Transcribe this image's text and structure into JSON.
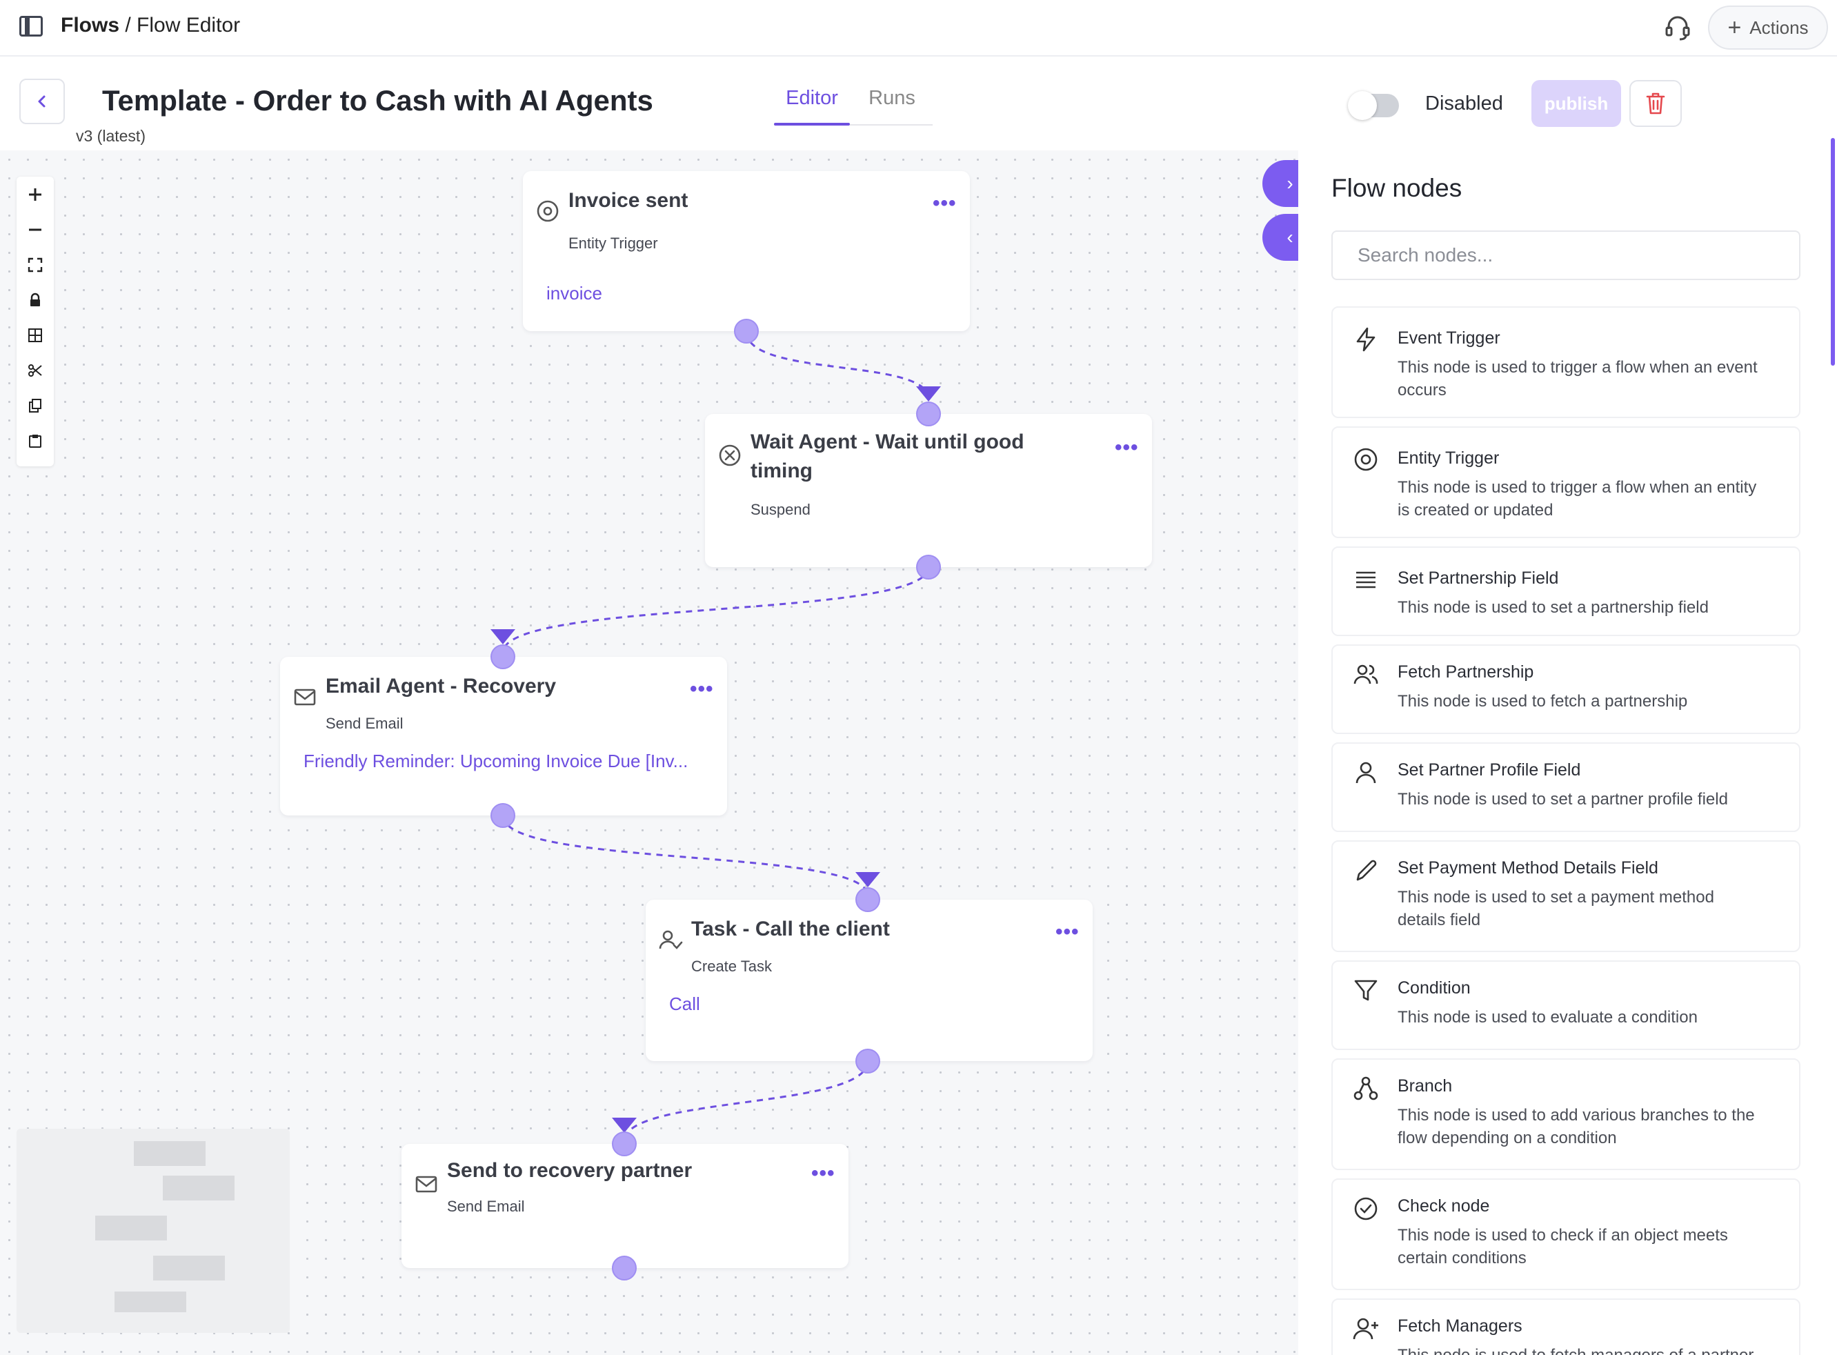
{
  "breadcrumb": {
    "root": "Flows",
    "separator": " / ",
    "current": "Flow Editor"
  },
  "header": {
    "title": "Template - Order to Cash with AI Agents",
    "version": "v3 (latest)",
    "tabs": [
      {
        "label": "Editor",
        "active": true
      },
      {
        "label": "Runs",
        "active": false
      }
    ],
    "status_label": "Disabled",
    "publish_label": "publish"
  },
  "actions_label": "Actions",
  "nodes": [
    {
      "title": "Invoice sent",
      "type": "Entity Trigger",
      "detail": "invoice",
      "icon": "target-icon"
    },
    {
      "title": "Wait Agent - Wait until good timing",
      "title_line1": "Wait Agent - Wait until good",
      "title_line2": "timing",
      "type": "Suspend",
      "detail": "",
      "icon": "x-circle-icon"
    },
    {
      "title": "Email Agent - Recovery",
      "type": "Send Email",
      "detail": "Friendly Reminder: Upcoming Invoice Due [Inv...",
      "icon": "mail-icon"
    },
    {
      "title": "Task - Call the client",
      "type": "Create Task",
      "detail": "Call",
      "icon": "user-check-icon"
    },
    {
      "title": "Send to recovery partner",
      "type": "Send Email",
      "detail": "",
      "icon": "mail-icon"
    }
  ],
  "panel": {
    "title": "Flow nodes",
    "search_placeholder": "Search nodes...",
    "items": [
      {
        "title": "Event Trigger",
        "line1": "This node is used to trigger a flow when an event",
        "line2": "occurs",
        "icon": "lightning-icon"
      },
      {
        "title": "Entity Trigger",
        "line1": "This node is used to trigger a flow when an entity",
        "line2": "is created or updated",
        "icon": "target-icon"
      },
      {
        "title": "Set Partnership Field",
        "line1": "This node is used to set a partnership field",
        "line2": "",
        "icon": "lines-icon"
      },
      {
        "title": "Fetch Partnership",
        "line1": "This node is used to fetch a partnership",
        "line2": "",
        "icon": "users-icon"
      },
      {
        "title": "Set Partner Profile Field",
        "line1": "This node is used to set a partner profile field",
        "line2": "",
        "icon": "user-icon"
      },
      {
        "title": "Set Payment Method Details Field",
        "line1": "This node is used to set a payment method",
        "line2": "details field",
        "icon": "pencil-icon"
      },
      {
        "title": "Condition",
        "line1": "This node is used to evaluate a condition",
        "line2": "",
        "icon": "filter-icon"
      },
      {
        "title": "Branch",
        "line1": "This node is used to add various branches to the",
        "line2": "flow depending on a condition",
        "icon": "branch-icon"
      },
      {
        "title": "Check node",
        "line1": "This node is used to check if an object meets",
        "line2": "certain conditions",
        "icon": "check-circle-icon"
      },
      {
        "title": "Fetch Managers",
        "line1": "This node is used to fetch managers of a partner",
        "line2": "",
        "icon": "user-plus-icon"
      }
    ]
  },
  "colors": {
    "accent": "#6d4fe0",
    "handle": "#b3a4f7",
    "publish_disabled": "#dcd4fb",
    "delete": "#e5484d"
  }
}
